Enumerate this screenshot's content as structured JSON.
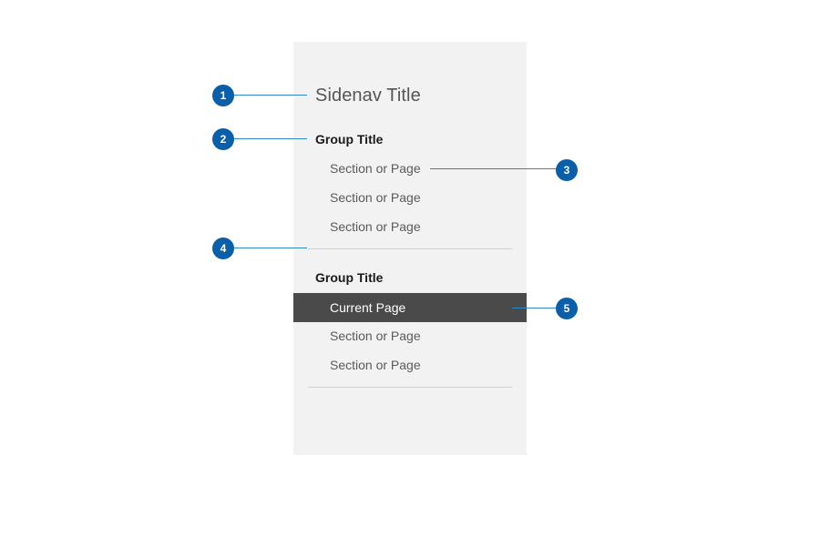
{
  "sidenav": {
    "title": "Sidenav Title",
    "groups": [
      {
        "title": "Group Title",
        "items": [
          "Section or Page",
          "Section or Page",
          "Section or Page"
        ]
      },
      {
        "title": "Group Title",
        "items": [
          "Current Page",
          "Section or Page",
          "Section or Page"
        ],
        "current_index": 0
      }
    ]
  },
  "callouts": [
    "1",
    "2",
    "3",
    "4",
    "5"
  ],
  "colors": {
    "panel_bg": "#f2f2f2",
    "current_bg": "#4a4a4a",
    "badge": "#0a5fa8",
    "callout_line": "#2f86c9",
    "divider": "#cfcfcf"
  }
}
